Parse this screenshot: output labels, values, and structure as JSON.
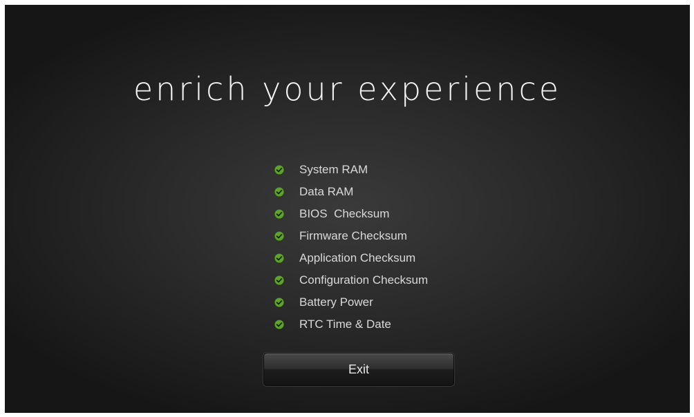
{
  "header": {
    "title": "enrich your experience"
  },
  "checklist": {
    "items": [
      {
        "label": "System RAM",
        "status": "passed"
      },
      {
        "label": "Data RAM",
        "status": "passed"
      },
      {
        "label": "BIOS  Checksum",
        "status": "passed"
      },
      {
        "label": "Firmware Checksum",
        "status": "passed"
      },
      {
        "label": "Application Checksum",
        "status": "passed"
      },
      {
        "label": "Configuration Checksum",
        "status": "passed"
      },
      {
        "label": "Battery Power",
        "status": "passed"
      },
      {
        "label": "RTC Time & Date",
        "status": "passed"
      }
    ],
    "icon": "green-check-circle-icon",
    "icon_color": "#5aa820"
  },
  "actions": {
    "exit_label": "Exit"
  },
  "colors": {
    "background": "#2b2b2b",
    "text": "#d9d9d9",
    "check_green": "#5aa820"
  }
}
